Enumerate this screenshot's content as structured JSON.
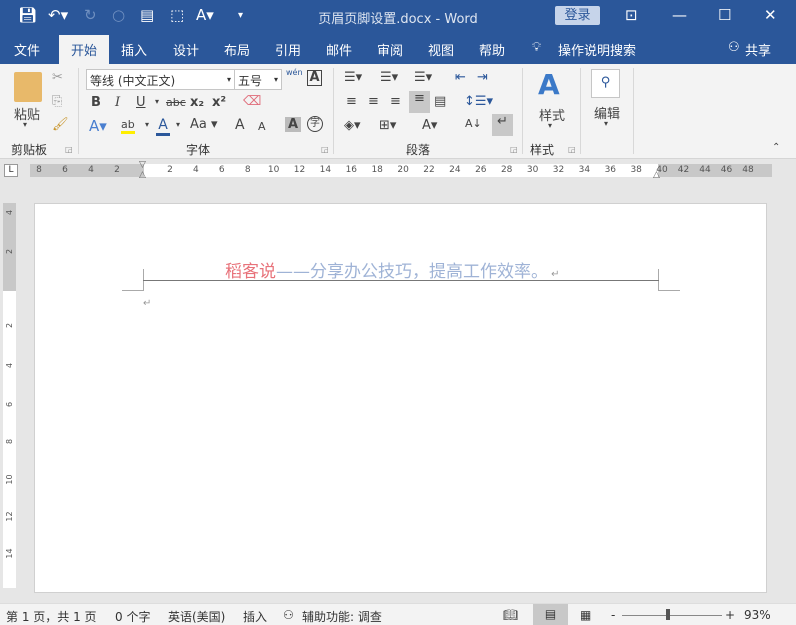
{
  "title_bar": {
    "doc_title": "页眉页脚设置.docx  -  Word",
    "login": "登录"
  },
  "tabs": [
    "文件",
    "开始",
    "插入",
    "设计",
    "布局",
    "引用",
    "邮件",
    "审阅",
    "视图",
    "帮助"
  ],
  "tell_me": "操作说明搜索",
  "share": "共享",
  "ribbon": {
    "clipboard": {
      "paste": "粘贴",
      "label": "剪贴板"
    },
    "font": {
      "name": "等线 (中文正文)",
      "size": "五号",
      "label": "字体",
      "bold": "B",
      "italic": "I",
      "underline": "U",
      "strike": "abc",
      "sub": "x₂",
      "sup": "x²",
      "case": "Aa",
      "grow": "A",
      "shrink": "A",
      "wen": "wén"
    },
    "paragraph": {
      "label": "段落"
    },
    "styles": {
      "button": "样式",
      "label": "样式"
    },
    "editing": {
      "button": "编辑"
    }
  },
  "ruler": {
    "h_left": [
      "8",
      "6",
      "4",
      "2"
    ],
    "h_main": [
      "2",
      "4",
      "6",
      "8",
      "10",
      "12",
      "14",
      "16",
      "18",
      "20",
      "22",
      "24",
      "26",
      "28",
      "30",
      "32",
      "34",
      "36",
      "38"
    ],
    "h_right": [
      "40",
      "42",
      "44",
      "46",
      "48"
    ],
    "v": [
      "4",
      "2",
      "2",
      "4",
      "6",
      "8",
      "10",
      "12",
      "14"
    ]
  },
  "document": {
    "header_red": "稻客说",
    "header_rest": "——分享办公技巧，提高工作效率。",
    "colors": {
      "red": "#e8727a",
      "blue": "#9fb3d6"
    }
  },
  "status": {
    "page": "第 1 页，共 1 页",
    "words": "0 个字",
    "lang": "英语(美国)",
    "mode": "插入",
    "accessibility": "辅助功能: 调查",
    "zoom": "93%",
    "zoom_value": 93
  }
}
